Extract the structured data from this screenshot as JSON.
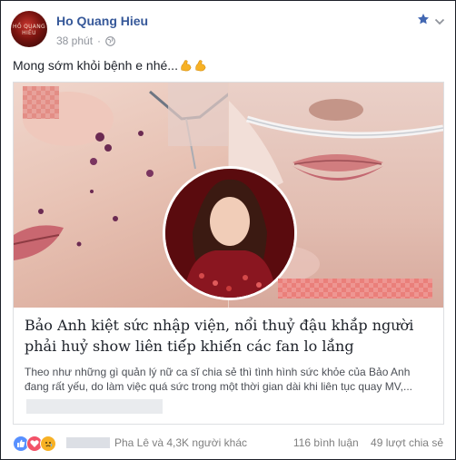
{
  "post": {
    "author": "Ho Quang Hieu",
    "time": "38 phút",
    "separator": "·",
    "caption": "Mong sớm khỏi bệnh e nhé...",
    "avatar_text": "HỒ QUANG HIẾU",
    "icons": {
      "privacy": "globe-icon",
      "favorite": "star-icon",
      "menu": "chevron-down-icon",
      "emoji": "flexed-biceps-emoji"
    }
  },
  "link_card": {
    "title": "Bảo Anh kiệt sức nhập viện, nổi thuỷ đậu khắ́p người phải huỷ show liên tiế́p khiế́n các fan lo lắ́ng",
    "description_line1": "Theo như những gì quản lý nữ ca sĩ chia sẻ thì tình hình sức khỏe của Bảo Anh",
    "description_line2": "đang rất yếu, do làm việc quá sức trong một thời gian dài khi liên tục quay MV,..."
  },
  "footer": {
    "reactions_text": "Pha Lê và 4,3K người khác",
    "comments": "116 bình luận",
    "shares": "49 lượt chia sẻ",
    "reaction_icons": [
      "like-reaction-icon",
      "love-reaction-icon",
      "sad-reaction-icon"
    ]
  },
  "colors": {
    "name_link": "#365899",
    "meta": "#90949c",
    "text": "#1d2129",
    "border": "#dddfe2",
    "like": "#5890ff",
    "love": "#f25268",
    "sad": "#f7b125"
  }
}
